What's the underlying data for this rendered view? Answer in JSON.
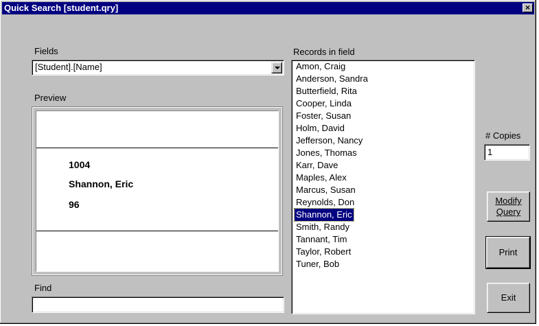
{
  "window": {
    "title": "Quick Search [student.qry]",
    "close_label": "×"
  },
  "fields": {
    "label": "Fields",
    "selected_value": "[Student].[Name]"
  },
  "preview": {
    "label": "Preview",
    "lines": [
      "1004",
      "Shannon, Eric",
      "96"
    ]
  },
  "find": {
    "label": "Find",
    "value": ""
  },
  "records": {
    "label": "Records in field",
    "items": [
      "Amon, Craig",
      "Anderson, Sandra",
      "Butterfield, Rita",
      "Cooper, Linda",
      "Foster, Susan",
      "Holm, David",
      "Jefferson, Nancy",
      "Jones, Thomas",
      "Karr, Dave",
      "Maples, Alex",
      "Marcus, Susan",
      "Reynolds, Don",
      "Shannon, Eric",
      "Smith, Randy",
      "Tannant, Tim",
      "Taylor, Robert",
      "Tuner, Bob"
    ],
    "selected": "Shannon, Eric"
  },
  "copies": {
    "label": "# Copies",
    "value": "1"
  },
  "buttons": {
    "modify_line1": "Modify",
    "modify_line2": "Query",
    "print_label": "Print",
    "exit_label": "Exit"
  },
  "colors": {
    "titlebar": "#000080",
    "face": "#c0c0c0",
    "selection": "#000080"
  }
}
